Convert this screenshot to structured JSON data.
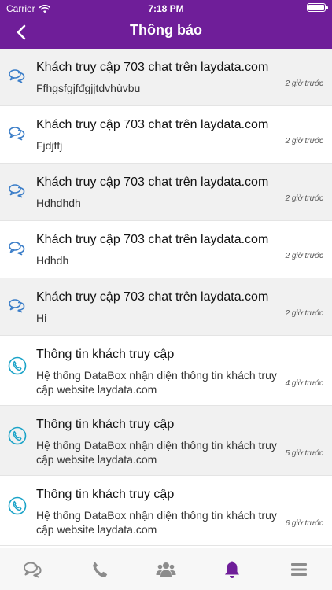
{
  "status_bar": {
    "carrier": "Carrier",
    "time": "7:18 PM"
  },
  "navbar": {
    "title": "Thông báo"
  },
  "notifications": [
    {
      "type": "chat",
      "title": "Khách truy cập 703 chat trên laydata.com",
      "message": "Ffhgsfgjfđgjjtdvhùvbu",
      "time": "2 giờ trước"
    },
    {
      "type": "chat",
      "title": "Khách truy cập 703 chat trên laydata.com",
      "message": "Fjdjffj",
      "time": "2 giờ trước"
    },
    {
      "type": "chat",
      "title": "Khách truy cập 703 chat trên laydata.com",
      "message": "Hdhdhdh",
      "time": "2 giờ trước"
    },
    {
      "type": "chat",
      "title": "Khách truy cập 703 chat trên laydata.com",
      "message": "Hdhdh",
      "time": "2 giờ trước"
    },
    {
      "type": "chat",
      "title": "Khách truy cập 703 chat trên laydata.com",
      "message": "Hi",
      "time": "2 giờ trước"
    },
    {
      "type": "phone",
      "title": "Thông tin khách truy cập",
      "message": "Hệ thống DataBox nhận diện thông tin khách truy cập website laydata.com",
      "time": "4 giờ trước"
    },
    {
      "type": "phone",
      "title": "Thông tin khách truy cập",
      "message": "Hệ thống DataBox nhận diện thông tin khách truy cập website laydata.com",
      "time": "5 giờ trước"
    },
    {
      "type": "phone",
      "title": "Thông tin khách truy cập",
      "message": "Hệ thống DataBox nhận diện thông tin khách truy cập website laydata.com",
      "time": "6 giờ trước"
    }
  ],
  "tabbar": {
    "items": [
      {
        "icon": "chat-bubbles-icon",
        "active": false
      },
      {
        "icon": "phone-icon",
        "active": false
      },
      {
        "icon": "users-group-icon",
        "active": false
      },
      {
        "icon": "bell-icon",
        "active": true
      },
      {
        "icon": "hamburger-menu-icon",
        "active": false
      }
    ]
  },
  "colors": {
    "header_bg": "#6f1e99",
    "accent": "#6f1e99",
    "chat_icon": "#3d7fc9",
    "phone_icon": "#1aa3c8",
    "tab_inactive": "#8c8c8c"
  }
}
